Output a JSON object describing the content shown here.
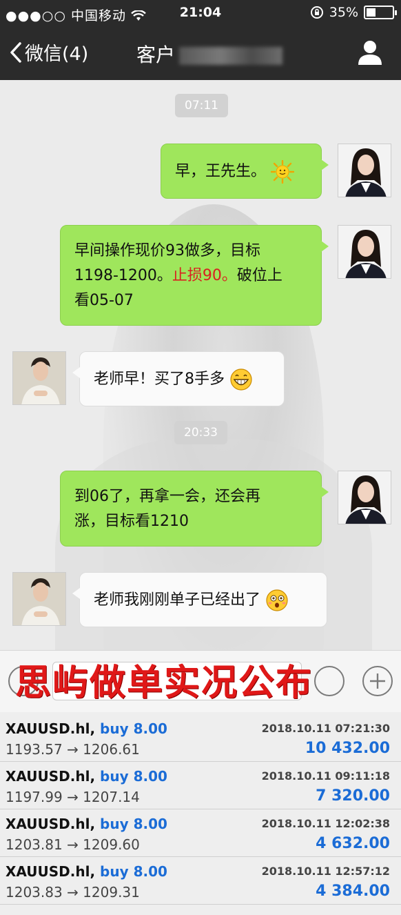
{
  "status_bar": {
    "signal": "●●●○○",
    "carrier": "中国移动",
    "time": "21:04",
    "battery": "35%",
    "battery_level": 0.35
  },
  "nav": {
    "back_label": "微信(4)",
    "title": "客户"
  },
  "messages": [
    {
      "type": "timestamp",
      "text": "07:11"
    },
    {
      "type": "sent",
      "text": "早，王先生。"
    },
    {
      "type": "sent",
      "text_a": "早间操作现价93做多，目标",
      "text_b": "1198-1200。",
      "text_red": "止损90。",
      "text_c": "破位上",
      "text_d": "看05-07"
    },
    {
      "type": "received",
      "text": "老师早！买了8手多"
    },
    {
      "type": "timestamp",
      "text": "20:33"
    },
    {
      "type": "sent",
      "text_a": "到06了，再拿一会，还会再",
      "text_b": "涨，目标看1210"
    },
    {
      "type": "received",
      "text": "老师我刚刚单子已经出了"
    }
  ],
  "overlay_title": "思屿做单实况公布",
  "trades": [
    {
      "symbol": "XAUUSD.hl,",
      "side": "buy 8.00",
      "datetime": "2018.10.11 07:21:30",
      "price": "1193.57 → 1206.61",
      "profit": "10 432.00"
    },
    {
      "symbol": "XAUUSD.hl,",
      "side": "buy 8.00",
      "datetime": "2018.10.11 09:11:18",
      "price": "1197.99 → 1207.14",
      "profit": "7 320.00"
    },
    {
      "symbol": "XAUUSD.hl,",
      "side": "buy 8.00",
      "datetime": "2018.10.11 12:02:38",
      "price": "1203.81 → 1209.60",
      "profit": "4 632.00"
    },
    {
      "symbol": "XAUUSD.hl,",
      "side": "buy 8.00",
      "datetime": "2018.10.11 12:57:12",
      "price": "1203.83 → 1209.31",
      "profit": "4 384.00"
    }
  ],
  "colors": {
    "sent_bubble": "#9fe65c",
    "nav_bg": "#2b2b2b",
    "profit_blue": "#1b6cd6",
    "title_red": "#e01818"
  }
}
